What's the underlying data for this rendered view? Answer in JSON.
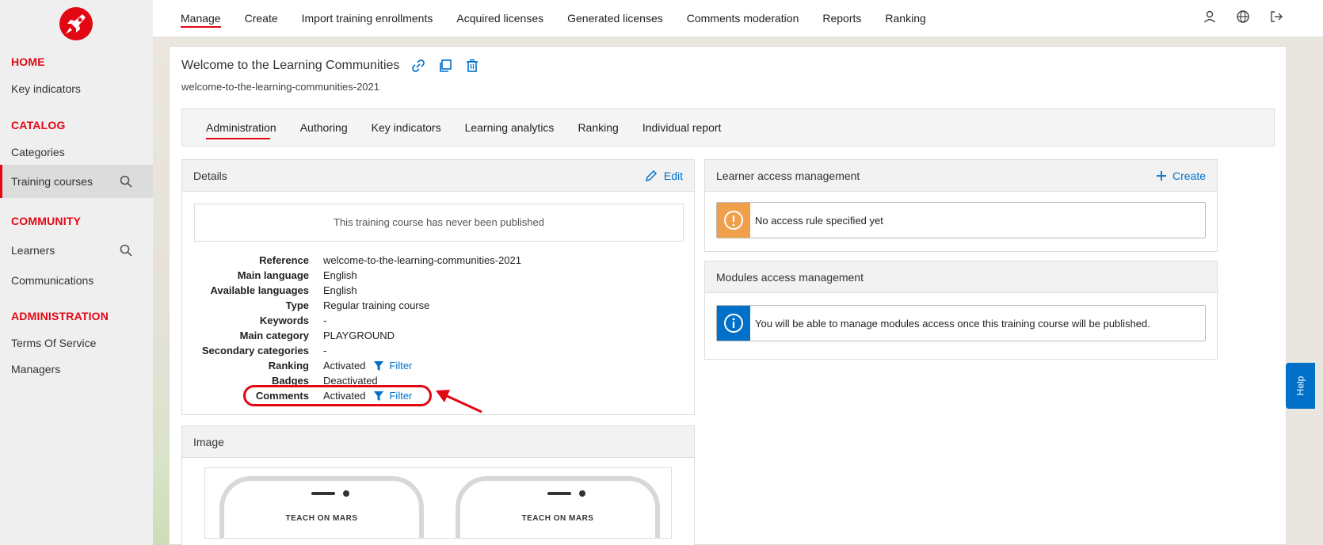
{
  "sidebar": {
    "sections": [
      {
        "title": "HOME",
        "items": [
          {
            "label": "Key indicators"
          }
        ]
      },
      {
        "title": "CATALOG",
        "items": [
          {
            "label": "Categories"
          },
          {
            "label": "Training courses"
          }
        ]
      },
      {
        "title": "COMMUNITY",
        "items": [
          {
            "label": "Learners"
          },
          {
            "label": "Communications"
          }
        ]
      },
      {
        "title": "ADMINISTRATION",
        "items": [
          {
            "label": "Terms Of Service"
          },
          {
            "label": "Managers"
          }
        ]
      }
    ],
    "active_item": "Training courses"
  },
  "topnav": {
    "items": [
      "Manage",
      "Create",
      "Import training enrollments",
      "Acquired licenses",
      "Generated licenses",
      "Comments moderation",
      "Reports",
      "Ranking"
    ],
    "active": "Manage",
    "icons": [
      "user-icon",
      "globe-icon",
      "logout-icon"
    ]
  },
  "page": {
    "title": "Welcome to the Learning Communities",
    "slug": "welcome-to-the-learning-communities-2021"
  },
  "tabs": {
    "items": [
      "Administration",
      "Authoring",
      "Key indicators",
      "Learning analytics",
      "Ranking",
      "Individual report"
    ],
    "active": "Administration"
  },
  "details": {
    "header": "Details",
    "edit_label": "Edit",
    "notice": "This training course has never been published",
    "rows": [
      {
        "label": "Reference",
        "value": "welcome-to-the-learning-communities-2021"
      },
      {
        "label": "Main language",
        "value": "English"
      },
      {
        "label": "Available languages",
        "value": "English"
      },
      {
        "label": "Type",
        "value": "Regular training course"
      },
      {
        "label": "Keywords",
        "value": "-"
      },
      {
        "label": "Main category",
        "value": "PLAYGROUND"
      },
      {
        "label": "Secondary categories",
        "value": "-"
      },
      {
        "label": "Ranking",
        "value": "Activated",
        "filter": "Filter"
      },
      {
        "label": "Badges",
        "value": "Deactivated"
      },
      {
        "label": "Comments",
        "value": "Activated",
        "filter": "Filter"
      }
    ]
  },
  "image_card": {
    "header": "Image",
    "brand_text": "TEACH ON MARS"
  },
  "learner_access": {
    "header": "Learner access management",
    "create_label": "Create",
    "alert": "No access rule specified yet",
    "alert_color": "#f0a04b"
  },
  "modules_access": {
    "header": "Modules access management",
    "alert": "You will be able to manage modules access once this training course will be published.",
    "alert_color": "#0070c9"
  },
  "help": {
    "label": "Help"
  },
  "colors": {
    "accent": "#e30613",
    "link": "#0070c9"
  }
}
